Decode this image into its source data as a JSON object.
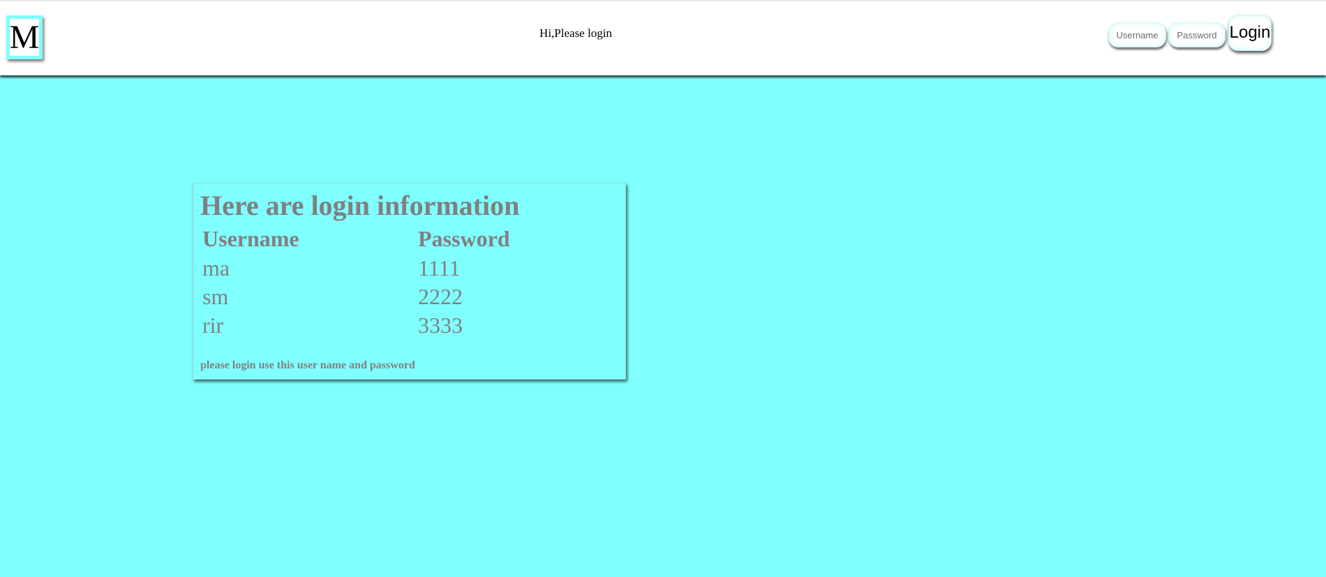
{
  "header": {
    "logo_letter": "M",
    "greeting": "Hi,Please login",
    "login_form": {
      "username_placeholder": "Username",
      "password_placeholder": "Password",
      "login_label": "Login"
    }
  },
  "info_card": {
    "title": "Here are login information",
    "columns": [
      "Username",
      "Password"
    ],
    "rows": [
      [
        "ma",
        "1111"
      ],
      [
        "sm",
        "2222"
      ],
      [
        "rir",
        "3333"
      ]
    ],
    "note": "please login use this user name and password"
  },
  "colors": {
    "background": "#80ffff",
    "header_background": "#ffffff",
    "card_text": "#808080"
  }
}
